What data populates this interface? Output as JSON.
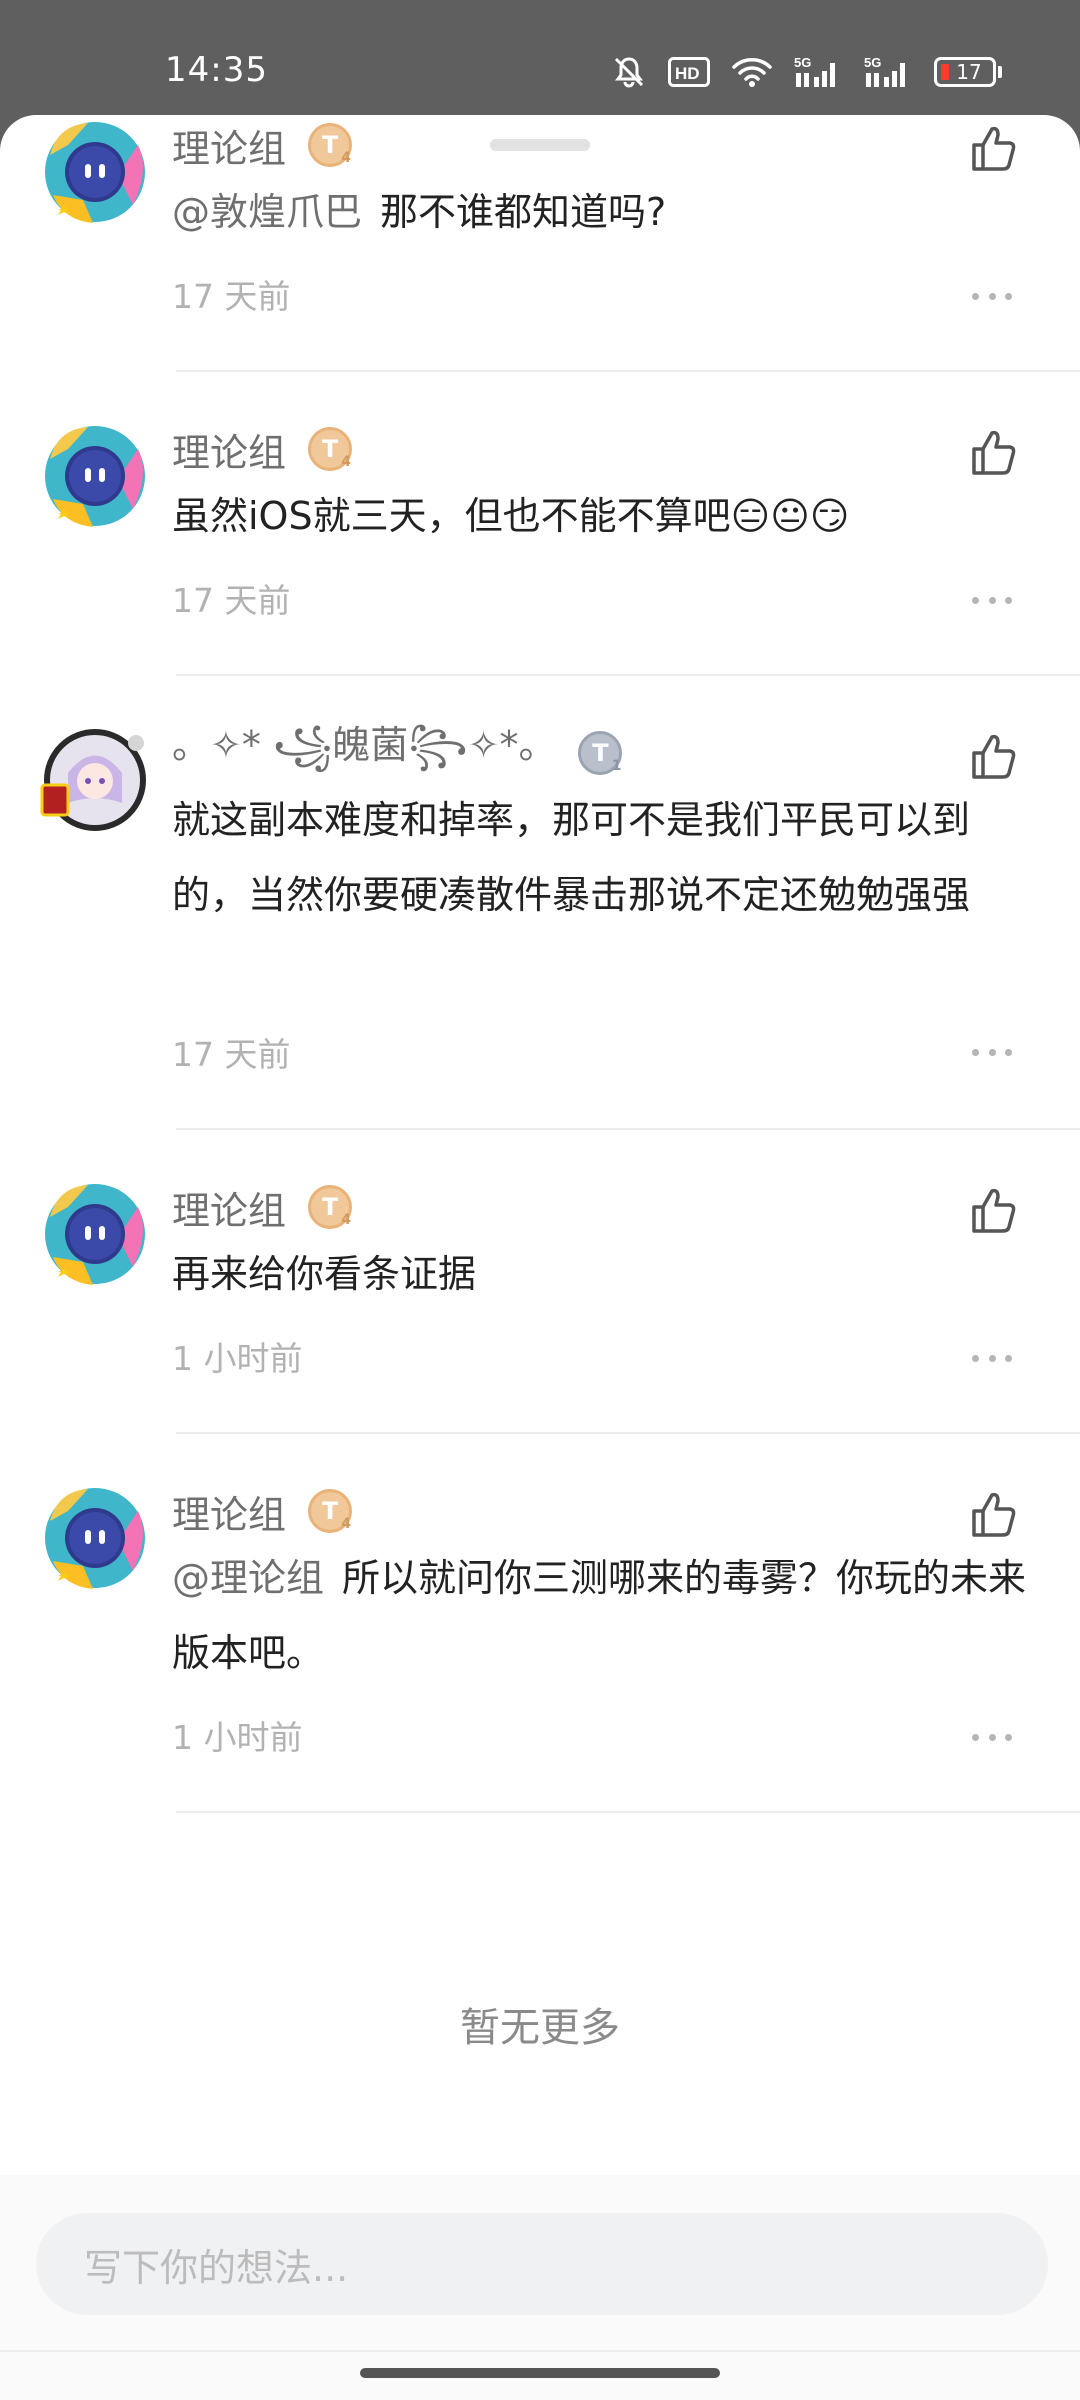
{
  "status_bar": {
    "time": "14:35",
    "hd_label": "HD",
    "net1": "5G",
    "net2": "5G",
    "battery": "17"
  },
  "comments": [
    {
      "name": "理论组",
      "badge": "T",
      "mention": "@敦煌爪巴",
      "text": "那不谁都知道吗?",
      "time": "17 天前",
      "avatar": "robot-avatar"
    },
    {
      "name": "理论组",
      "badge": "T",
      "mention": "",
      "text": "虽然iOS就三天，但也不能不算吧😑😐😏",
      "time": "17 天前",
      "avatar": "robot-avatar"
    },
    {
      "name": "。✧* ꧁魄菌꧂✧*。",
      "badge": "T",
      "mention": "",
      "text": "就这副本难度和掉率，那可不是我们平民可以到的，当然你要硬凑散件暴击那说不定还勉勉强强",
      "time": "17 天前",
      "avatar": "anime-girl-avatar"
    },
    {
      "name": "理论组",
      "badge": "T",
      "mention": "",
      "text": "再来给你看条证据",
      "time": "1 小时前",
      "avatar": "robot-avatar"
    },
    {
      "name": "理论组",
      "badge": "T",
      "mention": "@理论组",
      "text": "所以就问你三测哪来的毒雾？你玩的未来版本吧。",
      "time": "1 小时前",
      "avatar": "robot-avatar"
    }
  ],
  "footer": {
    "no_more": "暂无更多",
    "input_placeholder": "写下你的想法..."
  },
  "colors": {
    "status_bg": "#5f5f5f",
    "badge_gold": "#f0c89a",
    "badge_gray": "#b9c0cc",
    "battery_low": "#ff3b30"
  }
}
